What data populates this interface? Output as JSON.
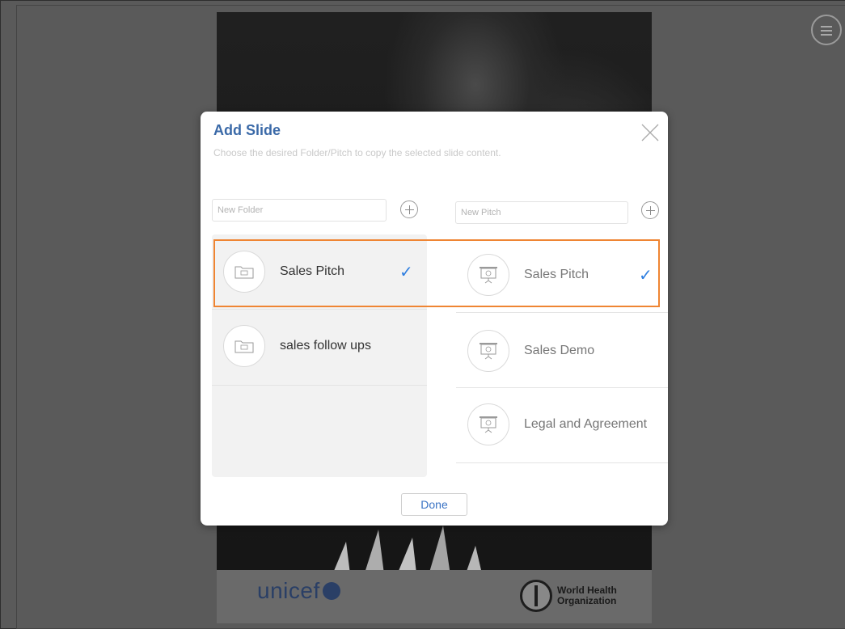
{
  "background": {
    "logos": {
      "unicef": "unicef",
      "who_line1": "World Health",
      "who_line2": "Organization"
    }
  },
  "menu": {
    "icon": "menu-icon"
  },
  "modal": {
    "title": "Add Slide",
    "subtitle": "Choose the desired Folder/Pitch to copy the selected slide content.",
    "folder_input": {
      "placeholder": "New Folder",
      "value": ""
    },
    "pitch_input": {
      "placeholder": "New Pitch",
      "value": ""
    },
    "folders": [
      {
        "label": "Sales Pitch",
        "selected": true,
        "icon": "folder-icon"
      },
      {
        "label": "sales follow ups",
        "selected": false,
        "icon": "folder-icon"
      }
    ],
    "pitches": [
      {
        "label": "Sales Pitch",
        "selected": true,
        "icon": "presentation-icon"
      },
      {
        "label": "Sales Demo",
        "selected": false,
        "icon": "presentation-icon"
      },
      {
        "label": "Legal and Agreement",
        "selected": false,
        "icon": "presentation-icon"
      }
    ],
    "check_mark": "✓",
    "done_label": "Done"
  },
  "colors": {
    "accent": "#3b6aa8",
    "check": "#2f7fe0",
    "highlight": "#ef8533"
  }
}
